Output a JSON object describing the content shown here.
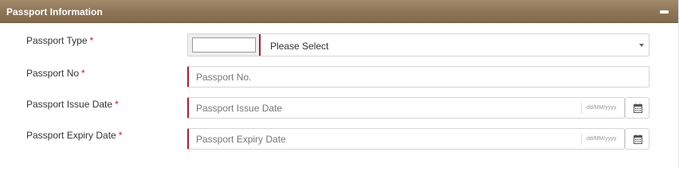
{
  "panel": {
    "title": "Passport Information",
    "collapse_icon": "minus-icon"
  },
  "fields": {
    "passport_type": {
      "label": "Passport Type",
      "required_mark": "*",
      "prefix_value": "",
      "selected_value": "Please Select",
      "dropdown_icon": "caret-down-icon"
    },
    "passport_no": {
      "label": "Passport No",
      "required_mark": "*",
      "value": "",
      "placeholder": "Passport No."
    },
    "issue_date": {
      "label": "Passport Issue Date",
      "required_mark": "*",
      "value": "",
      "placeholder": "Passport Issue Date",
      "format_hint": "dd/MM/yyyy",
      "calendar_icon": "calendar-icon"
    },
    "expiry_date": {
      "label": "Passport Expiry Date",
      "required_mark": "*",
      "value": "",
      "placeholder": "Passport Expiry Date",
      "format_hint": "dd/MM/yyyy",
      "calendar_icon": "calendar-icon"
    }
  },
  "colors": {
    "header_bg": "#8d7455",
    "required": "#c8102e",
    "field_accent": "#b01c2e"
  }
}
